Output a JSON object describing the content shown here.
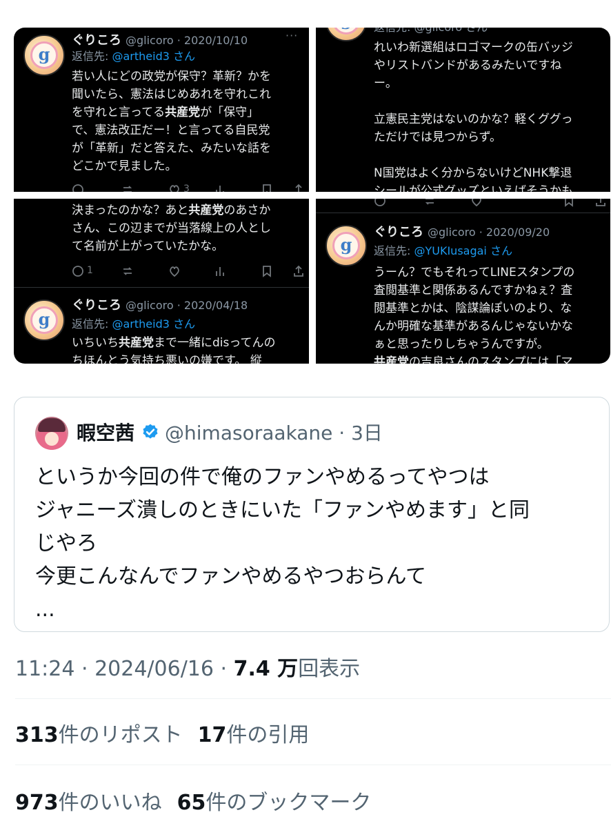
{
  "panels": {
    "top_left": {
      "name": "ぐりころ",
      "handle": "@glicoro · 2020/10/10",
      "more": "···",
      "reply_prefix": "返信先: ",
      "reply_to": "@artheid3",
      "reply_suffix": " さん",
      "body": {
        "l1": "若い人にどの政党が保守？革新？かを",
        "l2": "聞いたら、憲法はじめあれを守れこれ",
        "l3a": "を守れと言ってる",
        "l3b": "共産党",
        "l3c": "が「保守」",
        "l4": "で、憲法改正だー！と言ってる自民党",
        "l5": "が「革新」だと答えた、みたいな話を",
        "l6": "どこかで見ました。"
      },
      "likes": "3"
    },
    "top_right": {
      "reply_partial": "返信先: @glicoro さん",
      "body": {
        "l1": "れいわ新選組はロゴマークの缶バッジ",
        "l2": "やリストバンドがあるみたいですね",
        "l3": "ー。",
        "l4": "",
        "l5": "立憲民主党はないのかな？軽くググっ",
        "l6": "ただけでは見つからず。",
        "l7": "",
        "l8": "N国党はよく分からないけどNHK撃退",
        "l9": "シールが公式グッズといえばそうかも"
      }
    },
    "bottom_left": {
      "body": {
        "l1a": "決まったのかな？あと",
        "l1b": "共産党",
        "l1c": "のあさか",
        "l2": "さん、この辺までが当落線上の人とし",
        "l3": "て名前が上がっていたかな。"
      },
      "replies": "1",
      "name": "ぐりころ",
      "handle": "@glicoro · 2020/04/18",
      "reply_prefix": "返信先: ",
      "reply_to": "@artheid3",
      "reply_suffix": " さん",
      "body2": {
        "l1a": "いちいち",
        "l1b": "共産党",
        "l1c": "まで一緒にdisってんの",
        "l2": "ちほんとう気持ち悪いの嫌です。 縦"
      }
    },
    "bottom_right": {
      "name": "ぐりころ",
      "handle": "@glicoro · 2020/09/20",
      "reply_prefix": "返信先: ",
      "reply_to": "@YUKIusagai",
      "reply_suffix": " さん",
      "body": {
        "l1": "うーん？でもそれってLINEスタンプの",
        "l2": "査閲基準と関係あるんですかねぇ？査",
        "l3": "閲基準とかは、陰謀論ぽいのより、な",
        "l4": "んか明確な基準があるんじゃないかな",
        "l5": "ぁと思ったりしちゃうんですが。",
        "l6a": "共産党",
        "l6b": "の吉良さんのスタンプには「マ"
      }
    }
  },
  "quote": {
    "name": "暇空茜",
    "handle": "@himasoraakane · 3日",
    "lines": [
      "というか今回の件で俺のファンやめるってやつは",
      "ジャニーズ潰しのときにいた「ファンやめます」と同",
      "じやろ",
      "今更こんなんでファンやめるやつおらんて",
      "..."
    ]
  },
  "meta": {
    "time": "11:24 · 2024/06/16 · ",
    "views": "7.4 万",
    "views_label": "回表示"
  },
  "stats": {
    "reposts": "313",
    "reposts_label": "件のリポスト",
    "quotes": "17",
    "quotes_label": "件の引用",
    "likes": "973",
    "likes_label": "件のいいね",
    "bookmarks": "65",
    "bookmarks_label": "件のブックマーク"
  },
  "colors": {
    "link": "#1d9bf0",
    "verified": "#1d9bf0",
    "panel_bg": "#000000",
    "muted": "#536471"
  }
}
